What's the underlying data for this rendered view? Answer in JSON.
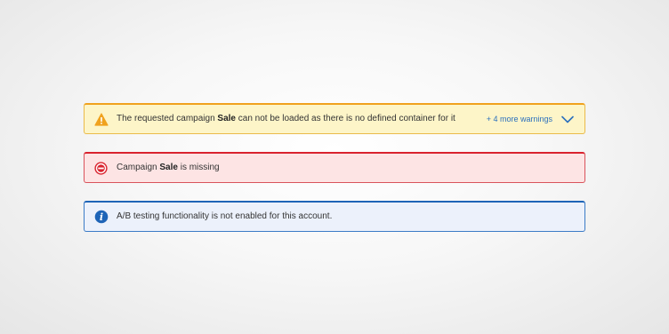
{
  "alerts": {
    "warning": {
      "icon": "warning-icon",
      "text_before": "The requested campaign ",
      "text_bold": "Sale",
      "text_after": " can not be loaded as there is no defined container for it",
      "more_link": "+ 4 more warnings",
      "toggle_icon": "chevron-down-icon",
      "accent_color": "#f0a21e"
    },
    "error": {
      "icon": "no-entry-icon",
      "text_before": "Campaign ",
      "text_bold": "Sale",
      "text_after": " is missing",
      "accent_color": "#d9232e"
    },
    "info": {
      "icon": "info-icon",
      "text": "A/B testing functionality is not enabled for this account.",
      "accent_color": "#1e64b7"
    }
  }
}
